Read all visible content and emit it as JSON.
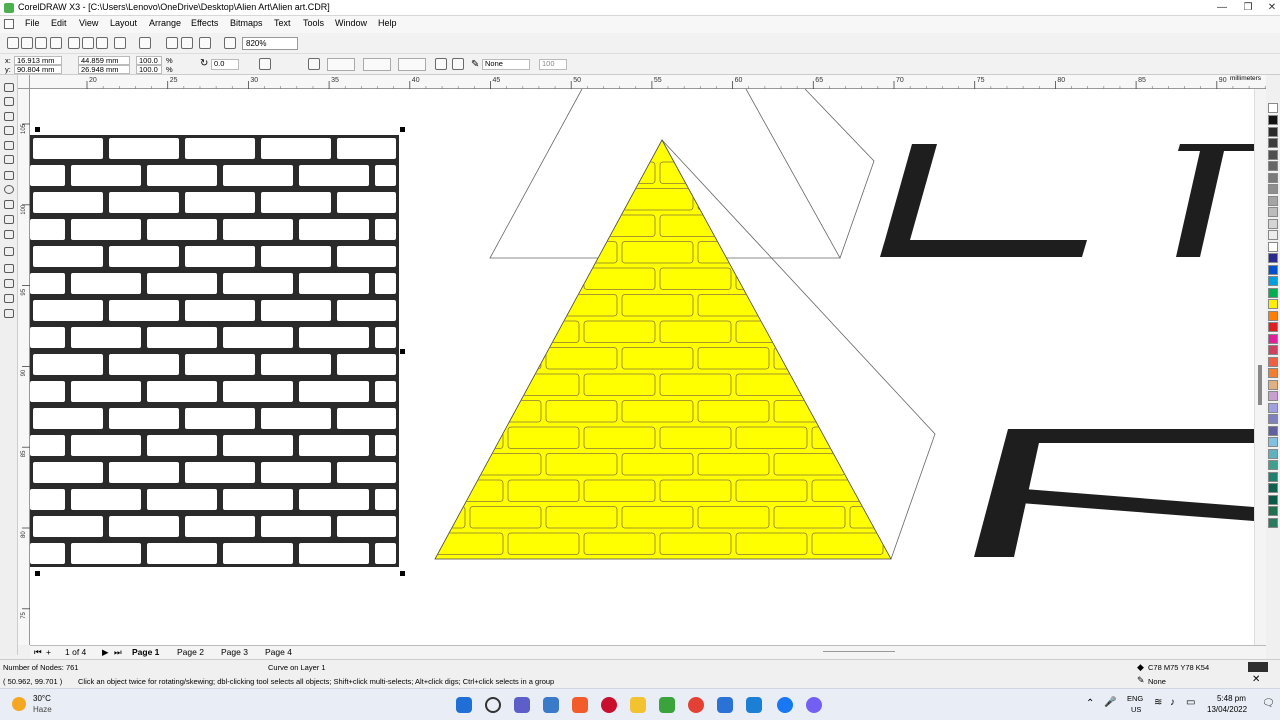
{
  "window": {
    "title": "CorelDRAW X3 - [C:\\Users\\Lenovo\\OneDrive\\Desktop\\Alien Art\\Alien art.CDR]"
  },
  "menu": [
    "File",
    "Edit",
    "View",
    "Layout",
    "Arrange",
    "Effects",
    "Bitmaps",
    "Text",
    "Tools",
    "Window",
    "Help"
  ],
  "toolbar": {
    "zoom": "820%"
  },
  "propbar": {
    "x": "16.913 mm",
    "y": "90.804 mm",
    "w": "44.859 mm",
    "h": "26.948 mm",
    "sx": "100.0",
    "sy": "100.0",
    "pct": "%",
    "angle": "0.0",
    "outline": "None",
    "opacity": "100"
  },
  "ruler_h": {
    "ticks": [
      "20",
      "25",
      "30",
      "35",
      "40",
      "45",
      "50",
      "55",
      "60",
      "65",
      "70",
      "75",
      "80",
      "85",
      "90"
    ],
    "unit": "millimeters"
  },
  "ruler_v": {
    "ticks": [
      "105",
      "100",
      "95",
      "90",
      "85",
      "80",
      "75"
    ],
    "unit": "millimeters"
  },
  "canvas_text": {
    "line1": "L I",
    "line2": "F"
  },
  "pages": {
    "indicator": "1 of 4",
    "tabs": [
      "Page 1",
      "Page 2",
      "Page 3",
      "Page 4"
    ]
  },
  "status": {
    "nodes": "Number of Nodes: 761",
    "layer": "Curve on Layer 1",
    "coords": "( 50.962, 99.701 )",
    "hint": "Click an object twice for rotating/skewing; dbl-clicking tool selects all objects; Shift+click multi-selects; Alt+click digs; Ctrl+click selects in a group",
    "fill": "C78 M75 Y78 K54",
    "outline": "None"
  },
  "taskbar": {
    "weather_temp": "30°C",
    "weather_desc": "Haze",
    "lang1": "ENG",
    "lang2": "US",
    "time": "5:48 pm",
    "date": "13/04/2022"
  },
  "colors": {
    "brick_fill": "#ffff00",
    "brick_outline": "#8a7a3a",
    "brick_dark": "#2a2a2a",
    "text_fill": "#1e1e1e"
  }
}
